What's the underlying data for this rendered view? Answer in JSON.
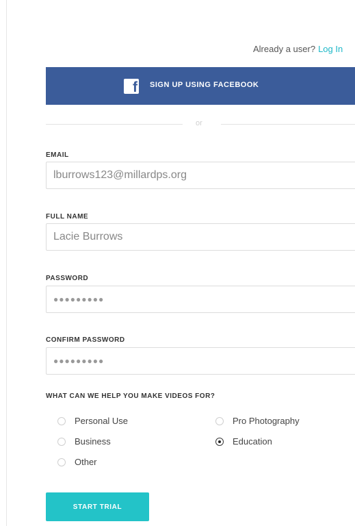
{
  "header": {
    "already_user_text": "Already a user?",
    "login_link": "Log In"
  },
  "facebook": {
    "glyph": "f",
    "label": "SIGN UP USING FACEBOOK",
    "color": "#3b5c9a"
  },
  "divider": {
    "text": "or"
  },
  "form": {
    "email": {
      "label": "EMAIL",
      "value": "lburrows123@millardps.org"
    },
    "full_name": {
      "label": "FULL NAME",
      "value": "Lacie Burrows"
    },
    "password": {
      "label": "PASSWORD",
      "value": "●●●●●●●●●"
    },
    "confirm_password": {
      "label": "CONFIRM PASSWORD",
      "value": "●●●●●●●●●"
    }
  },
  "purpose": {
    "question": "WHAT CAN WE HELP YOU MAKE VIDEOS FOR?",
    "options": [
      {
        "label": "Personal Use",
        "checked": false
      },
      {
        "label": "Pro Photography",
        "checked": false
      },
      {
        "label": "Business",
        "checked": false
      },
      {
        "label": "Education",
        "checked": true
      },
      {
        "label": "Other",
        "checked": false
      }
    ]
  },
  "submit": {
    "label": "START TRIAL",
    "color": "#23c3c8"
  }
}
